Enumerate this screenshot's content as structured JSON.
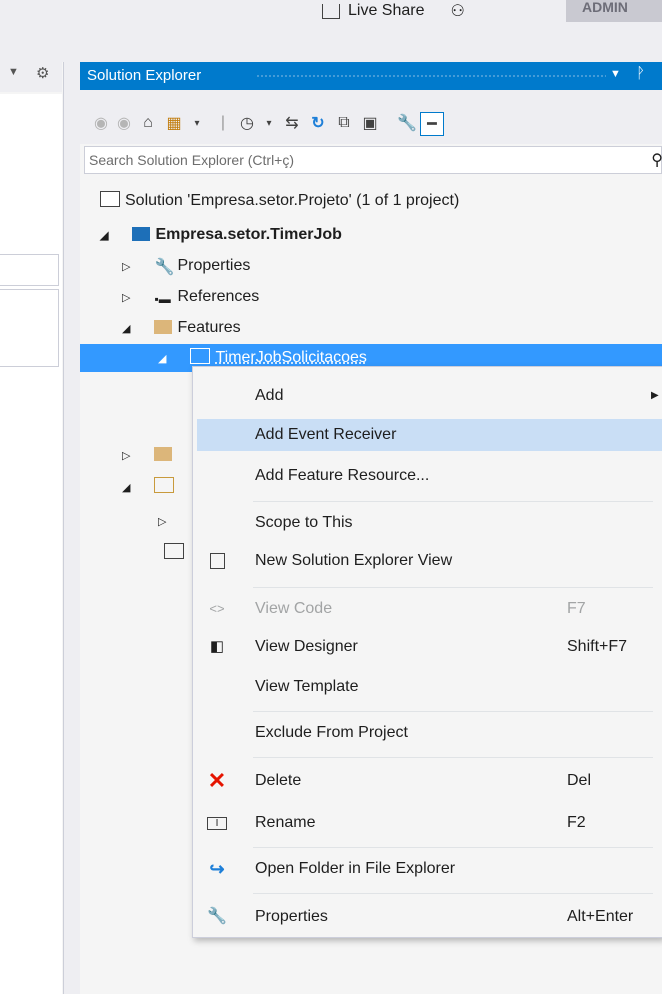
{
  "header": {
    "live_share_label": "Live Share",
    "account_label": "ADMIN"
  },
  "solution_explorer": {
    "title": "Solution Explorer",
    "search_placeholder": "Search Solution Explorer (Ctrl+ç)",
    "tree": {
      "solution": "Solution 'Empresa.setor.Projeto' (1 of 1 project)",
      "project": "Empresa.setor.TimerJob",
      "properties": "Properties",
      "references": "References",
      "features": "Features",
      "feature_item": "TimerJobSolicitacoes"
    }
  },
  "context_menu": {
    "items": [
      {
        "label": "Add",
        "shortcut": ""
      },
      {
        "label": "Add Event Receiver",
        "shortcut": ""
      },
      {
        "label": "Add Feature Resource...",
        "shortcut": ""
      },
      {
        "label": "Scope to This",
        "shortcut": ""
      },
      {
        "label": "New Solution Explorer View",
        "shortcut": ""
      },
      {
        "label": "View Code",
        "shortcut": "F7"
      },
      {
        "label": "View Designer",
        "shortcut": "Shift+F7"
      },
      {
        "label": "View Template",
        "shortcut": ""
      },
      {
        "label": "Exclude From Project",
        "shortcut": ""
      },
      {
        "label": "Delete",
        "shortcut": "Del"
      },
      {
        "label": "Rename",
        "shortcut": "F2"
      },
      {
        "label": "Open Folder in File Explorer",
        "shortcut": ""
      },
      {
        "label": "Properties",
        "shortcut": "Alt+Enter"
      }
    ]
  },
  "colors": {
    "accent": "#007acc",
    "selection": "#3399ff",
    "menu_highlight": "#c9def5",
    "delete_red": "#e51400"
  }
}
